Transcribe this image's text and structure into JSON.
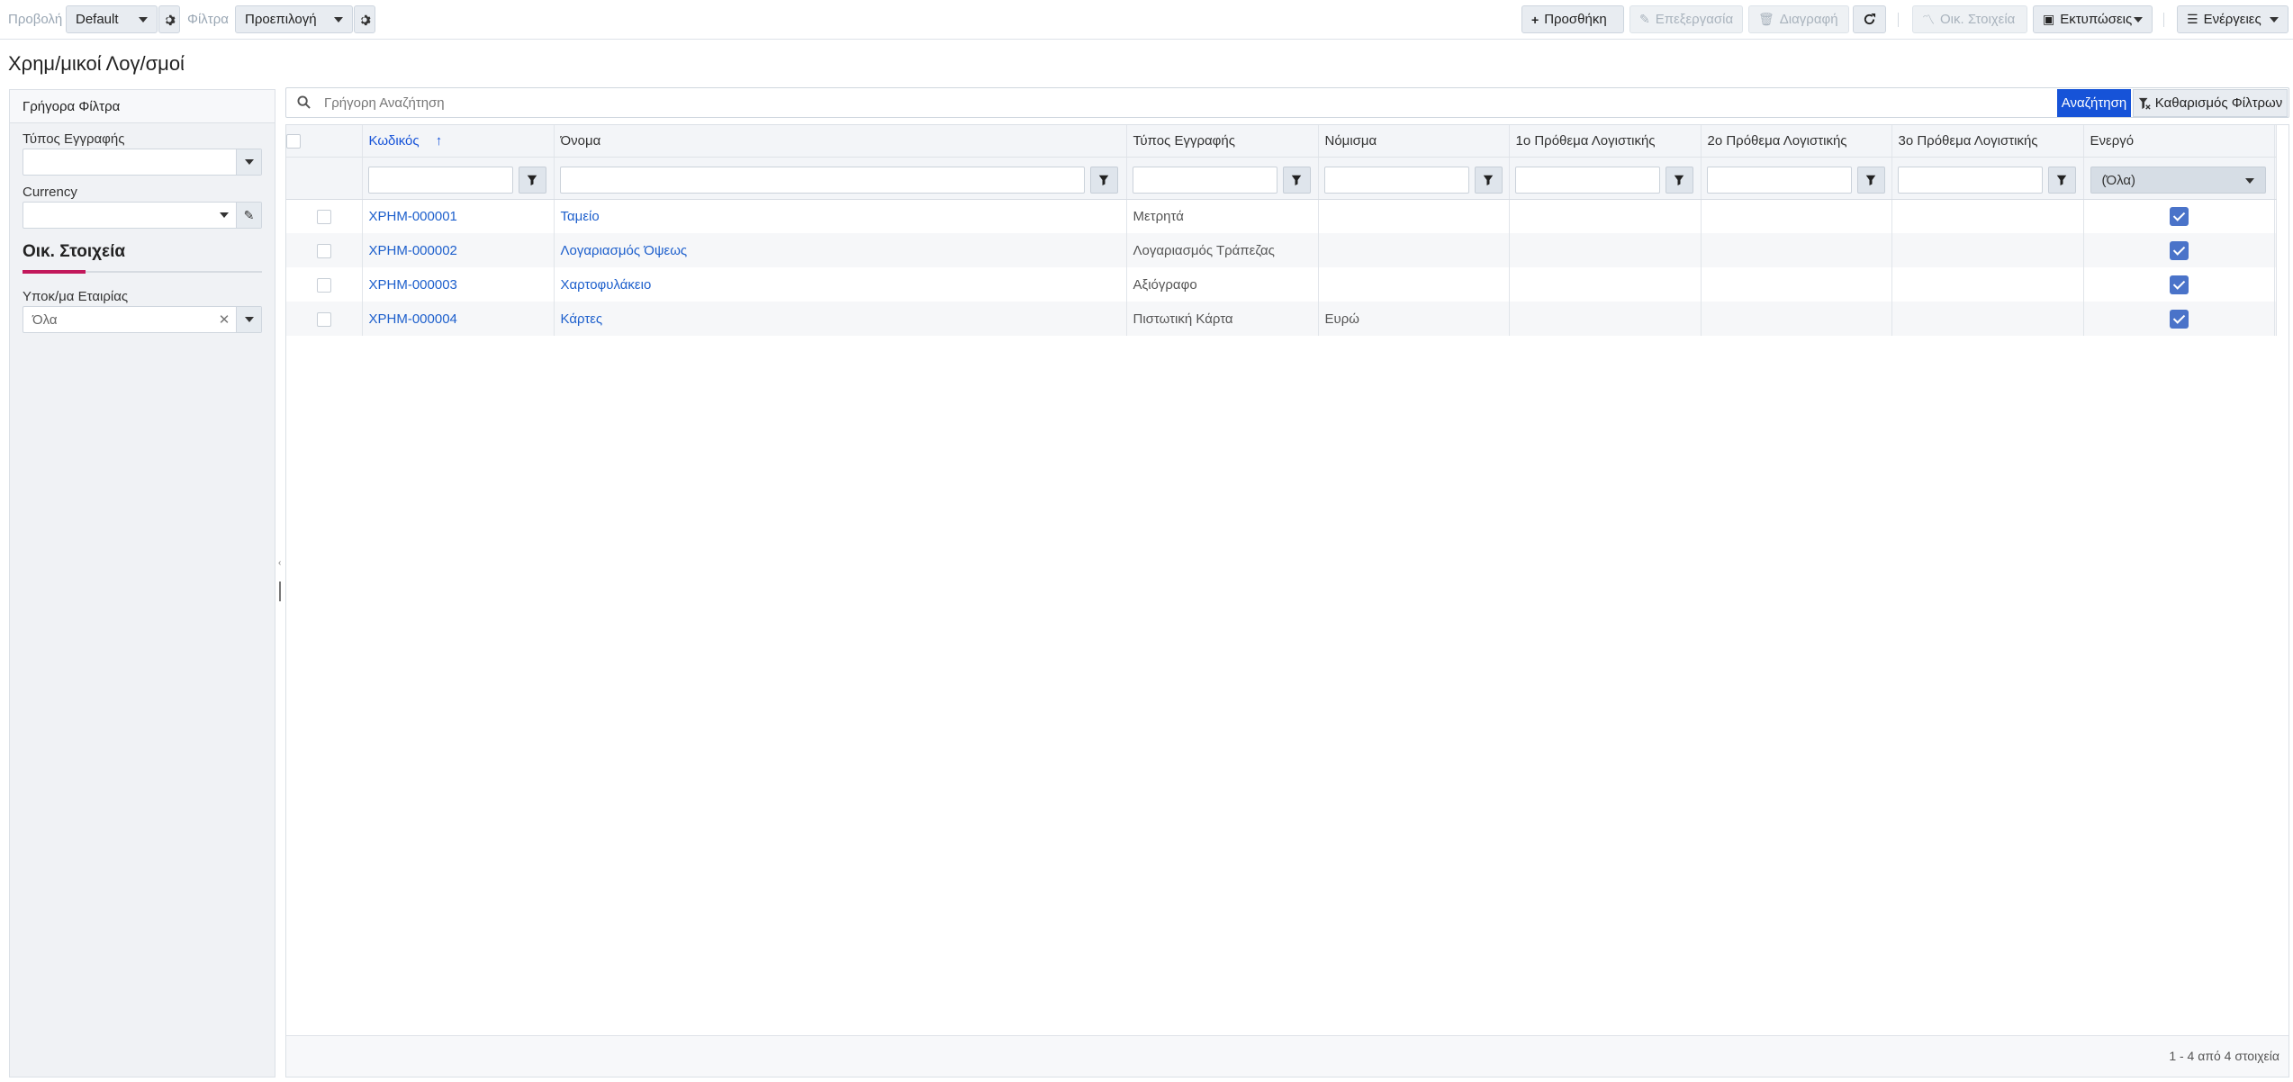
{
  "toolbar": {
    "view_label": "Προβολή",
    "view_value": "Default",
    "filters_label": "Φίλτρα",
    "filters_value": "Προεπιλογή",
    "add_label": "Προσθήκη",
    "edit_label": "Επεξεργασία",
    "delete_label": "Διαγραφή",
    "fin_label": "Οικ. Στοιχεία",
    "print_label": "Εκτυπώσεις",
    "actions_label": "Ενέργειες"
  },
  "page": {
    "title": "Χρημ/μικοί Λογ/σμοί"
  },
  "sidebar": {
    "header": "Γρήγορα Φίλτρα",
    "record_type_label": "Τύπος Εγγραφής",
    "record_type_value": "",
    "currency_label": "Currency",
    "currency_value": "",
    "section_title": "Οικ. Στοιχεία",
    "branch_label": "Υποκ/μα Εταιρίας",
    "branch_value": "Όλα"
  },
  "search": {
    "placeholder": "Γρήγορη Αναζήτηση",
    "value": "",
    "search_button": "Αναζήτηση",
    "clear_button": "Καθαρισμός Φίλτρων"
  },
  "grid": {
    "columns": [
      "Κωδικός",
      "Όνομα",
      "Τύπος Εγγραφής",
      "Νόμισμα",
      "1ο Πρόθεμα Λογιστικής",
      "2ο Πρόθεμα Λογιστικής",
      "3ο Πρόθεμα Λογιστικής",
      "Ενεργό"
    ],
    "active_filter_value": "(Όλα)",
    "rows": [
      {
        "code": "ΧΡΗΜ-000001",
        "name": "Ταμείο",
        "type": "Μετρητά",
        "currency": "",
        "p1": "",
        "p2": "",
        "p3": "",
        "active": true
      },
      {
        "code": "ΧΡΗΜ-000002",
        "name": "Λογαριασμός Όψεως",
        "type": "Λογαριασμός Τράπεζας",
        "currency": "",
        "p1": "",
        "p2": "",
        "p3": "",
        "active": true
      },
      {
        "code": "ΧΡΗΜ-000003",
        "name": "Χαρτοφυλάκειο",
        "type": "Αξιόγραφο",
        "currency": "",
        "p1": "",
        "p2": "",
        "p3": "",
        "active": true
      },
      {
        "code": "ΧΡΗΜ-000004",
        "name": "Κάρτες",
        "type": "Πιστωτική Κάρτα",
        "currency": "Ευρώ",
        "p1": "",
        "p2": "",
        "p3": "",
        "active": true
      }
    ],
    "footer": "1 - 4 από 4 στοιχεία"
  }
}
